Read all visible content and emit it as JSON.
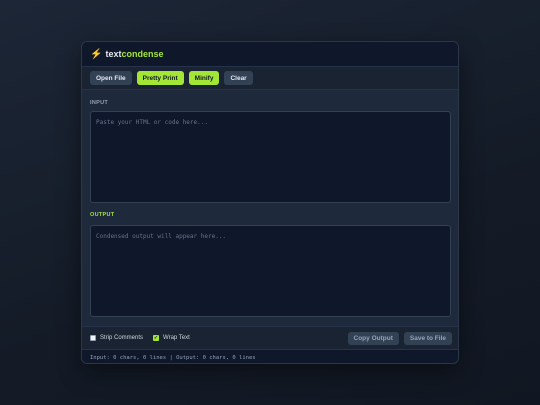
{
  "app": {
    "title_prefix": "text",
    "title_suffix": "condense",
    "icon": "lightning-bolt-icon"
  },
  "toolbar": {
    "open_file": "Open File",
    "pretty_print": "Pretty Print",
    "minify": "Minify",
    "clear": "Clear"
  },
  "input": {
    "label": "INPUT",
    "placeholder": "Paste your HTML or code here...",
    "value": ""
  },
  "output": {
    "label": "OUTPUT",
    "placeholder": "Condensed output will appear here...",
    "value": ""
  },
  "options": {
    "strip_comments": {
      "label": "Strip Comments",
      "checked": false
    },
    "wrap_text": {
      "label": "Wrap Text",
      "checked": true
    }
  },
  "actions": {
    "copy_output": "Copy Output",
    "save_to_file": "Save to File"
  },
  "status": {
    "text": "Input: 0 chars, 0 lines | Output: 0 chars, 0 lines"
  },
  "colors": {
    "accent": "#a3e635",
    "background": "#1e293b",
    "panel": "#0f172a",
    "bolt": "#facc15"
  }
}
